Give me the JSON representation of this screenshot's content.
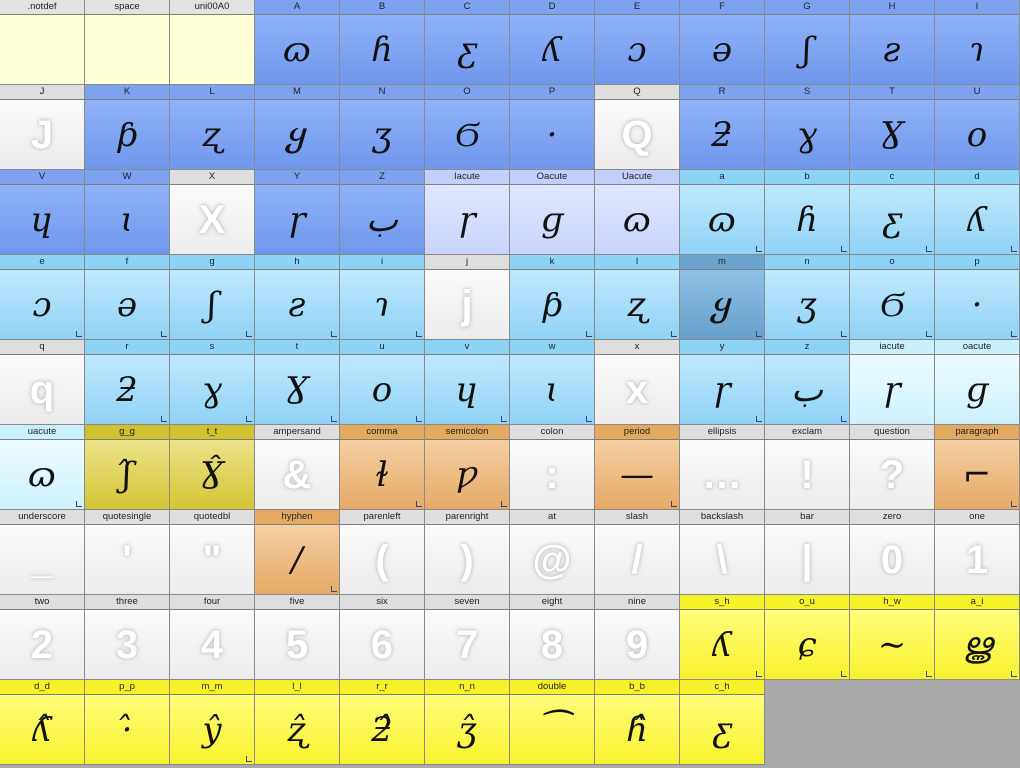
{
  "glyph_cells": [
    {
      "name": ".notdef",
      "glyph": "",
      "style": "empty",
      "marker": false
    },
    {
      "name": "space",
      "glyph": "",
      "style": "empty",
      "marker": false
    },
    {
      "name": "uni00A0",
      "glyph": "",
      "style": "empty",
      "marker": false
    },
    {
      "name": "A",
      "glyph": "ɷ",
      "style": "blue",
      "marker": false
    },
    {
      "name": "B",
      "glyph": "ɦ",
      "style": "blue",
      "marker": false
    },
    {
      "name": "C",
      "glyph": "ƹ",
      "style": "blue",
      "marker": false
    },
    {
      "name": "D",
      "glyph": "ʎ",
      "style": "blue",
      "marker": false
    },
    {
      "name": "E",
      "glyph": "ɔ",
      "style": "blue",
      "marker": false
    },
    {
      "name": "F",
      "glyph": "ə",
      "style": "blue",
      "marker": false
    },
    {
      "name": "G",
      "glyph": "ʃ",
      "style": "blue",
      "marker": false
    },
    {
      "name": "H",
      "glyph": "ƨ",
      "style": "blue",
      "marker": false
    },
    {
      "name": "I",
      "glyph": "ɿ",
      "style": "blue",
      "marker": false
    },
    {
      "name": "J",
      "glyph": "J",
      "style": "plain",
      "marker": false
    },
    {
      "name": "K",
      "glyph": "ƥ",
      "style": "blue",
      "marker": false
    },
    {
      "name": "L",
      "glyph": "ʐ",
      "style": "blue",
      "marker": false
    },
    {
      "name": "M",
      "glyph": "ყ",
      "style": "blue",
      "marker": false
    },
    {
      "name": "N",
      "glyph": "ʒ",
      "style": "blue",
      "marker": false
    },
    {
      "name": "O",
      "glyph": "Ϭ",
      "style": "blue",
      "marker": false
    },
    {
      "name": "P",
      "glyph": "·",
      "style": "blue",
      "marker": false
    },
    {
      "name": "Q",
      "glyph": "Q",
      "style": "plain",
      "marker": false
    },
    {
      "name": "R",
      "glyph": "ƻ",
      "style": "blue",
      "marker": false
    },
    {
      "name": "S",
      "glyph": "ɣ",
      "style": "blue",
      "marker": false
    },
    {
      "name": "T",
      "glyph": "Ɣ",
      "style": "blue",
      "marker": false
    },
    {
      "name": "U",
      "glyph": "o",
      "style": "blue",
      "marker": false
    },
    {
      "name": "V",
      "glyph": "ɥ",
      "style": "blue",
      "marker": false
    },
    {
      "name": "W",
      "glyph": "ɩ",
      "style": "blue",
      "marker": false
    },
    {
      "name": "X",
      "glyph": "X",
      "style": "plain",
      "marker": false
    },
    {
      "name": "Y",
      "glyph": "ɼ",
      "style": "blue",
      "marker": false
    },
    {
      "name": "Z",
      "glyph": "ب",
      "style": "blue",
      "marker": false
    },
    {
      "name": "Iacute",
      "glyph": "ɼ",
      "style": "lilac",
      "marker": false
    },
    {
      "name": "Oacute",
      "glyph": "ɡ",
      "style": "lilac",
      "marker": false
    },
    {
      "name": "Uacute",
      "glyph": "ɷ",
      "style": "lilac",
      "marker": false
    },
    {
      "name": "a",
      "glyph": "ɷ",
      "style": "cyan",
      "marker": true
    },
    {
      "name": "b",
      "glyph": "ɦ",
      "style": "cyan",
      "marker": true
    },
    {
      "name": "c",
      "glyph": "ƹ",
      "style": "cyan",
      "marker": true
    },
    {
      "name": "d",
      "glyph": "ʎ",
      "style": "cyan",
      "marker": true
    },
    {
      "name": "e",
      "glyph": "ɔ",
      "style": "cyan",
      "marker": true
    },
    {
      "name": "f",
      "glyph": "ə",
      "style": "cyan",
      "marker": true
    },
    {
      "name": "g",
      "glyph": "ʃ",
      "style": "cyan",
      "marker": true
    },
    {
      "name": "h",
      "glyph": "ƨ",
      "style": "cyan",
      "marker": true
    },
    {
      "name": "i",
      "glyph": "ɿ",
      "style": "cyan",
      "marker": true
    },
    {
      "name": "j",
      "glyph": "j",
      "style": "plain",
      "marker": false
    },
    {
      "name": "k",
      "glyph": "ƥ",
      "style": "cyan",
      "marker": true
    },
    {
      "name": "l",
      "glyph": "ʐ",
      "style": "cyan",
      "marker": true
    },
    {
      "name": "m",
      "glyph": "ყ",
      "style": "sel",
      "marker": true
    },
    {
      "name": "n",
      "glyph": "ʒ",
      "style": "cyan",
      "marker": true
    },
    {
      "name": "o",
      "glyph": "Ϭ",
      "style": "cyan",
      "marker": true
    },
    {
      "name": "p",
      "glyph": "·",
      "style": "cyan",
      "marker": true
    },
    {
      "name": "q",
      "glyph": "q",
      "style": "plain",
      "marker": false
    },
    {
      "name": "r",
      "glyph": "ƻ",
      "style": "cyan",
      "marker": true
    },
    {
      "name": "s",
      "glyph": "ɣ",
      "style": "cyan",
      "marker": true
    },
    {
      "name": "t",
      "glyph": "Ɣ",
      "style": "cyan",
      "marker": true
    },
    {
      "name": "u",
      "glyph": "o",
      "style": "cyan",
      "marker": true
    },
    {
      "name": "v",
      "glyph": "ɥ",
      "style": "cyan",
      "marker": true
    },
    {
      "name": "w",
      "glyph": "ɩ",
      "style": "cyan",
      "marker": true
    },
    {
      "name": "x",
      "glyph": "x",
      "style": "plain",
      "marker": false
    },
    {
      "name": "y",
      "glyph": "ɼ",
      "style": "cyan",
      "marker": true
    },
    {
      "name": "z",
      "glyph": "ب",
      "style": "cyan",
      "marker": true
    },
    {
      "name": "iacute",
      "glyph": "ɼ",
      "style": "lcyan",
      "marker": false
    },
    {
      "name": "oacute",
      "glyph": "ɡ",
      "style": "lcyan",
      "marker": false
    },
    {
      "name": "uacute",
      "glyph": "ɷ",
      "style": "lcyan",
      "marker": true
    },
    {
      "name": "g_g",
      "glyph": "ʃ̂",
      "style": "olive",
      "marker": false
    },
    {
      "name": "t_t",
      "glyph": "Ɣ̂",
      "style": "olive",
      "marker": false
    },
    {
      "name": "ampersand",
      "glyph": "&",
      "style": "plain",
      "marker": false
    },
    {
      "name": "comma",
      "glyph": "ɫ",
      "style": "orange",
      "marker": true
    },
    {
      "name": "semicolon",
      "glyph": "ƿ",
      "style": "orange",
      "marker": true
    },
    {
      "name": "colon",
      "glyph": ":",
      "style": "plain",
      "marker": false
    },
    {
      "name": "period",
      "glyph": "—",
      "style": "orange",
      "marker": true
    },
    {
      "name": "ellipsis",
      "glyph": "…",
      "style": "plain",
      "marker": false
    },
    {
      "name": "exclam",
      "glyph": "!",
      "style": "plain",
      "marker": false
    },
    {
      "name": "question",
      "glyph": "?",
      "style": "plain",
      "marker": false
    },
    {
      "name": "paragraph",
      "glyph": "⌐",
      "style": "orange",
      "marker": true
    },
    {
      "name": "underscore",
      "glyph": "_",
      "style": "plain",
      "marker": false
    },
    {
      "name": "quotesingle",
      "glyph": "'",
      "style": "plain",
      "marker": false
    },
    {
      "name": "quotedbl",
      "glyph": "\"",
      "style": "plain",
      "marker": false
    },
    {
      "name": "hyphen",
      "glyph": "/",
      "style": "orange",
      "marker": true
    },
    {
      "name": "parenleft",
      "glyph": "(",
      "style": "plain",
      "marker": false
    },
    {
      "name": "parenright",
      "glyph": ")",
      "style": "plain",
      "marker": false
    },
    {
      "name": "at",
      "glyph": "@",
      "style": "plain",
      "marker": false
    },
    {
      "name": "slash",
      "glyph": "/",
      "style": "plain",
      "marker": false
    },
    {
      "name": "backslash",
      "glyph": "\\",
      "style": "plain",
      "marker": false
    },
    {
      "name": "bar",
      "glyph": "|",
      "style": "plain",
      "marker": false
    },
    {
      "name": "zero",
      "glyph": "0",
      "style": "plain",
      "marker": false
    },
    {
      "name": "one",
      "glyph": "1",
      "style": "plain",
      "marker": false
    },
    {
      "name": "two",
      "glyph": "2",
      "style": "plain",
      "marker": false
    },
    {
      "name": "three",
      "glyph": "3",
      "style": "plain",
      "marker": false
    },
    {
      "name": "four",
      "glyph": "4",
      "style": "plain",
      "marker": false
    },
    {
      "name": "five",
      "glyph": "5",
      "style": "plain",
      "marker": false
    },
    {
      "name": "six",
      "glyph": "6",
      "style": "plain",
      "marker": false
    },
    {
      "name": "seven",
      "glyph": "7",
      "style": "plain",
      "marker": false
    },
    {
      "name": "eight",
      "glyph": "8",
      "style": "plain",
      "marker": false
    },
    {
      "name": "nine",
      "glyph": "9",
      "style": "plain",
      "marker": false
    },
    {
      "name": "s_h",
      "glyph": "ʎ",
      "style": "yellow",
      "marker": true
    },
    {
      "name": "o_u",
      "glyph": "ɕ",
      "style": "yellow",
      "marker": true
    },
    {
      "name": "h_w",
      "glyph": "∼",
      "style": "yellow",
      "marker": true
    },
    {
      "name": "a_i",
      "glyph": "ൠ",
      "style": "yellow",
      "marker": true
    },
    {
      "name": "d_d",
      "glyph": "ʎ̂",
      "style": "yellow",
      "marker": false
    },
    {
      "name": "p_p",
      "glyph": "·̂",
      "style": "yellow",
      "marker": false
    },
    {
      "name": "m_m",
      "glyph": "ŷ",
      "style": "yellow",
      "marker": true
    },
    {
      "name": "l_l",
      "glyph": "ʐ̂",
      "style": "yellow",
      "marker": false
    },
    {
      "name": "r_r",
      "glyph": "ƻ̂",
      "style": "yellow",
      "marker": false
    },
    {
      "name": "n_n",
      "glyph": "ʒ̂",
      "style": "yellow",
      "marker": false
    },
    {
      "name": "double",
      "glyph": "⁀",
      "style": "yellow",
      "marker": false
    },
    {
      "name": "b_b",
      "glyph": "ɦ̂",
      "style": "yellow",
      "marker": false
    },
    {
      "name": "c_h",
      "glyph": "ƹ",
      "style": "yellow",
      "marker": false
    }
  ]
}
